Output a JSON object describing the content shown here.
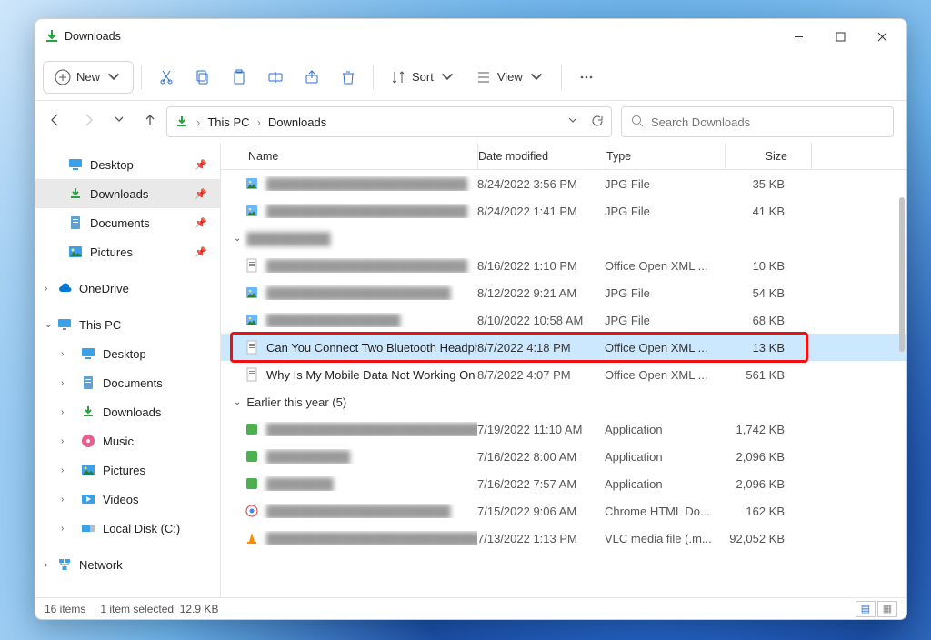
{
  "window": {
    "title": "Downloads"
  },
  "toolbar": {
    "new": "New",
    "sort": "Sort",
    "view": "View"
  },
  "breadcrumb": {
    "root": "This PC",
    "folder": "Downloads"
  },
  "search": {
    "placeholder": "Search Downloads"
  },
  "sidebar": {
    "quick": [
      {
        "label": "Desktop",
        "icon": "desktop"
      },
      {
        "label": "Downloads",
        "icon": "download",
        "active": true
      },
      {
        "label": "Documents",
        "icon": "doc"
      },
      {
        "label": "Pictures",
        "icon": "pic"
      }
    ],
    "onedrive": "OneDrive",
    "thispc": "This PC",
    "thispc_items": [
      {
        "label": "Desktop",
        "icon": "desktop"
      },
      {
        "label": "Documents",
        "icon": "doc"
      },
      {
        "label": "Downloads",
        "icon": "download"
      },
      {
        "label": "Music",
        "icon": "music"
      },
      {
        "label": "Pictures",
        "icon": "pic"
      },
      {
        "label": "Videos",
        "icon": "video"
      },
      {
        "label": "Local Disk (C:)",
        "icon": "disk"
      }
    ],
    "network": "Network"
  },
  "columns": {
    "name": "Name",
    "date": "Date modified",
    "type": "Type",
    "size": "Size"
  },
  "files": [
    {
      "blur": true,
      "icon": "jpg",
      "name": "████████████████████████",
      "date": "8/24/2022 3:56 PM",
      "type": "JPG File",
      "size": "35 KB"
    },
    {
      "blur": true,
      "icon": "jpg",
      "name": "████████████████████████",
      "date": "8/24/2022 1:41 PM",
      "type": "JPG File",
      "size": "41 KB"
    },
    {
      "group": true,
      "label": "██████████"
    },
    {
      "blur": true,
      "icon": "docx",
      "name": "████████████████████████",
      "date": "8/16/2022 1:10 PM",
      "type": "Office Open XML ...",
      "size": "10 KB"
    },
    {
      "blur": true,
      "icon": "jpg",
      "name": "██████████████████████",
      "date": "8/12/2022 9:21 AM",
      "type": "JPG File",
      "size": "54 KB"
    },
    {
      "blur": true,
      "icon": "jpg",
      "name": "████████████████",
      "date": "8/10/2022 10:58 AM",
      "type": "JPG File",
      "size": "68 KB"
    },
    {
      "icon": "docx",
      "name": "Can You Connect Two Bluetooth Headph...",
      "date": "8/7/2022 4:18 PM",
      "type": "Office Open XML ...",
      "size": "13 KB",
      "selected": true
    },
    {
      "icon": "docx",
      "name": "Why Is My Mobile Data Not Working On ...",
      "date": "8/7/2022 4:07 PM",
      "type": "Office Open XML ...",
      "size": "561 KB"
    },
    {
      "group": true,
      "label": "Earlier this year (5)"
    },
    {
      "blur": true,
      "icon": "app",
      "name": "████████████████████████████",
      "date": "7/19/2022 11:10 AM",
      "type": "Application",
      "size": "1,742 KB"
    },
    {
      "blur": true,
      "icon": "app",
      "name": "██████████",
      "date": "7/16/2022 8:00 AM",
      "type": "Application",
      "size": "2,096 KB"
    },
    {
      "blur": true,
      "icon": "app",
      "name": "████████",
      "date": "7/16/2022 7:57 AM",
      "type": "Application",
      "size": "2,096 KB"
    },
    {
      "blur": true,
      "icon": "html",
      "name": "██████████████████████",
      "date": "7/15/2022 9:06 AM",
      "type": "Chrome HTML Do...",
      "size": "162 KB"
    },
    {
      "blur": true,
      "icon": "vlc",
      "name": "████████████████████████████████",
      "date": "7/13/2022 1:13 PM",
      "type": "VLC media file (.m...",
      "size": "92,052 KB"
    }
  ],
  "status": {
    "items": "16 items",
    "selected": "1 item selected",
    "selsize": "12.9 KB"
  }
}
